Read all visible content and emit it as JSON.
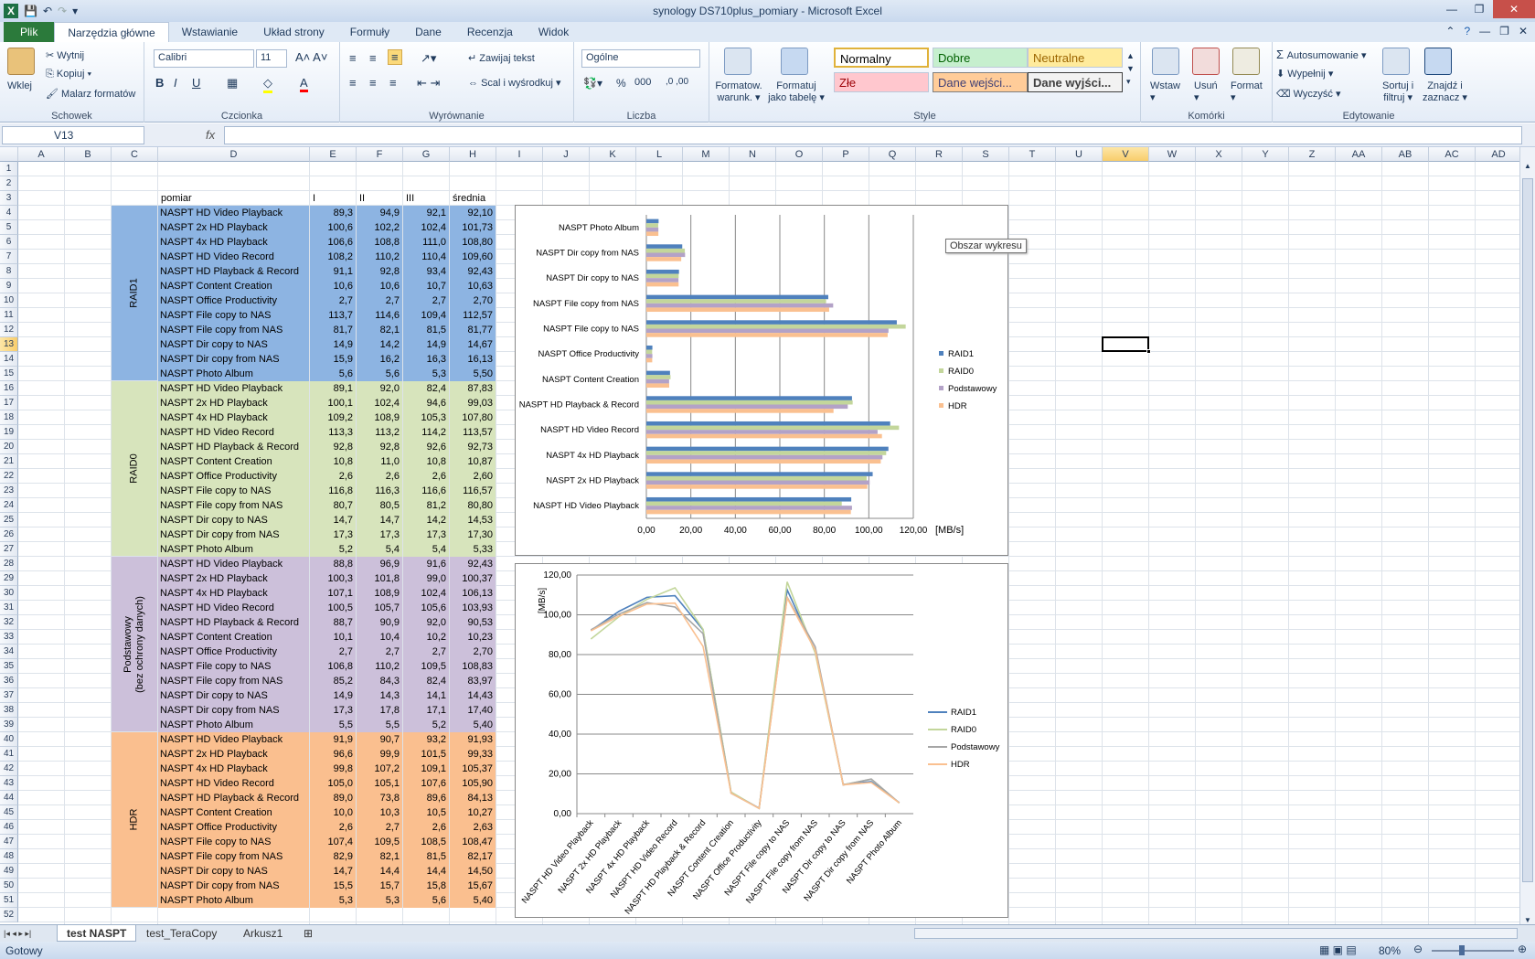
{
  "window": {
    "title": "synology DS710plus_pomiary  -  Microsoft Excel"
  },
  "ribbon_tabs": [
    "Plik",
    "Narzędzia główne",
    "Wstawianie",
    "Układ strony",
    "Formuły",
    "Dane",
    "Recenzja",
    "Widok"
  ],
  "ribbon": {
    "clipboard": {
      "paste": "Wklej",
      "cut": "Wytnij",
      "copy": "Kopiuj",
      "painter": "Malarz formatów",
      "label": "Schowek"
    },
    "font": {
      "name": "Calibri",
      "size": "11",
      "label": "Czcionka"
    },
    "alignment": {
      "wrap": "Zawijaj tekst",
      "merge": "Scal i wyśrodkuj",
      "label": "Wyrównanie"
    },
    "number": {
      "format": "Ogólne",
      "label": "Liczba"
    },
    "styles": {
      "cond_format": "Formatow.",
      "cond_format2": "warunk.",
      "as_table": "Formatuj",
      "as_table2": "jako tabelę",
      "normal": "Normalny",
      "good": "Dobre",
      "neutral": "Neutralne",
      "bad": "Złe",
      "input": "Dane wejści...",
      "output": "Dane wyjści...",
      "label": "Style"
    },
    "cells": {
      "insert": "Wstaw",
      "delete": "Usuń",
      "format": "Format",
      "label": "Komórki"
    },
    "editing": {
      "autosum": "Autosumowanie",
      "fill": "Wypełnij",
      "clear": "Wyczyść",
      "sort": "Sortuj i",
      "sort2": "filtruj",
      "find": "Znajdź i",
      "find2": "zaznacz",
      "label": "Edytowanie"
    }
  },
  "formula_bar": {
    "name_box": "V13",
    "fx": "fx",
    "value": ""
  },
  "columns": [
    "A",
    "B",
    "C",
    "D",
    "E",
    "F",
    "G",
    "H",
    "I",
    "J",
    "K",
    "L",
    "M",
    "N",
    "O",
    "P",
    "Q",
    "R",
    "S",
    "T",
    "U",
    "V",
    "W",
    "X",
    "Y",
    "Z",
    "AA",
    "AB",
    "AC",
    "AD"
  ],
  "table": {
    "headers": {
      "pomiar": "pomiar",
      "i": "I",
      "ii": "II",
      "iii": "III",
      "avg": "średnia"
    },
    "groups": [
      {
        "label": "RAID1",
        "color": "#8db4e2",
        "rows": [
          [
            "NASPT HD Video Playback",
            "89,3",
            "94,9",
            "92,1",
            "92,10"
          ],
          [
            "NASPT 2x HD Playback",
            "100,6",
            "102,2",
            "102,4",
            "101,73"
          ],
          [
            "NASPT 4x HD Playback",
            "106,6",
            "108,8",
            "111,0",
            "108,80"
          ],
          [
            "NASPT HD Video Record",
            "108,2",
            "110,2",
            "110,4",
            "109,60"
          ],
          [
            "NASPT HD Playback & Record",
            "91,1",
            "92,8",
            "93,4",
            "92,43"
          ],
          [
            "NASPT Content Creation",
            "10,6",
            "10,6",
            "10,7",
            "10,63"
          ],
          [
            "NASPT Office Productivity",
            "2,7",
            "2,7",
            "2,7",
            "2,70"
          ],
          [
            "NASPT File copy to NAS",
            "113,7",
            "114,6",
            "109,4",
            "112,57"
          ],
          [
            "NASPT File copy from NAS",
            "81,7",
            "82,1",
            "81,5",
            "81,77"
          ],
          [
            "NASPT Dir copy to NAS",
            "14,9",
            "14,2",
            "14,9",
            "14,67"
          ],
          [
            "NASPT Dir copy from NAS",
            "15,9",
            "16,2",
            "16,3",
            "16,13"
          ],
          [
            "NASPT Photo Album",
            "5,6",
            "5,6",
            "5,3",
            "5,50"
          ]
        ]
      },
      {
        "label": "RAID0",
        "color": "#d7e4bc",
        "rows": [
          [
            "NASPT HD Video Playback",
            "89,1",
            "92,0",
            "82,4",
            "87,83"
          ],
          [
            "NASPT 2x HD Playback",
            "100,1",
            "102,4",
            "94,6",
            "99,03"
          ],
          [
            "NASPT 4x HD Playback",
            "109,2",
            "108,9",
            "105,3",
            "107,80"
          ],
          [
            "NASPT HD Video Record",
            "113,3",
            "113,2",
            "114,2",
            "113,57"
          ],
          [
            "NASPT HD Playback & Record",
            "92,8",
            "92,8",
            "92,6",
            "92,73"
          ],
          [
            "NASPT Content Creation",
            "10,8",
            "11,0",
            "10,8",
            "10,87"
          ],
          [
            "NASPT Office Productivity",
            "2,6",
            "2,6",
            "2,6",
            "2,60"
          ],
          [
            "NASPT File copy to NAS",
            "116,8",
            "116,3",
            "116,6",
            "116,57"
          ],
          [
            "NASPT File copy from NAS",
            "80,7",
            "80,5",
            "81,2",
            "80,80"
          ],
          [
            "NASPT Dir copy to NAS",
            "14,7",
            "14,7",
            "14,2",
            "14,53"
          ],
          [
            "NASPT Dir copy from NAS",
            "17,3",
            "17,3",
            "17,3",
            "17,30"
          ],
          [
            "NASPT Photo Album",
            "5,2",
            "5,4",
            "5,4",
            "5,33"
          ]
        ]
      },
      {
        "label": "Podstawowy",
        "label2": "(bez ochrony danych)",
        "color": "#ccc0da",
        "rows": [
          [
            "NASPT HD Video Playback",
            "88,8",
            "96,9",
            "91,6",
            "92,43"
          ],
          [
            "NASPT 2x HD Playback",
            "100,3",
            "101,8",
            "99,0",
            "100,37"
          ],
          [
            "NASPT 4x HD Playback",
            "107,1",
            "108,9",
            "102,4",
            "106,13"
          ],
          [
            "NASPT HD Video Record",
            "100,5",
            "105,7",
            "105,6",
            "103,93"
          ],
          [
            "NASPT HD Playback & Record",
            "88,7",
            "90,9",
            "92,0",
            "90,53"
          ],
          [
            "NASPT Content Creation",
            "10,1",
            "10,4",
            "10,2",
            "10,23"
          ],
          [
            "NASPT Office Productivity",
            "2,7",
            "2,7",
            "2,7",
            "2,70"
          ],
          [
            "NASPT File copy to NAS",
            "106,8",
            "110,2",
            "109,5",
            "108,83"
          ],
          [
            "NASPT File copy from NAS",
            "85,2",
            "84,3",
            "82,4",
            "83,97"
          ],
          [
            "NASPT Dir copy to NAS",
            "14,9",
            "14,3",
            "14,1",
            "14,43"
          ],
          [
            "NASPT Dir copy from NAS",
            "17,3",
            "17,8",
            "17,1",
            "17,40"
          ],
          [
            "NASPT Photo Album",
            "5,5",
            "5,5",
            "5,2",
            "5,40"
          ]
        ]
      },
      {
        "label": "HDR",
        "color": "#fabf8f",
        "rows": [
          [
            "NASPT HD Video Playback",
            "91,9",
            "90,7",
            "93,2",
            "91,93"
          ],
          [
            "NASPT 2x HD Playback",
            "96,6",
            "99,9",
            "101,5",
            "99,33"
          ],
          [
            "NASPT 4x HD Playback",
            "99,8",
            "107,2",
            "109,1",
            "105,37"
          ],
          [
            "NASPT HD Video Record",
            "105,0",
            "105,1",
            "107,6",
            "105,90"
          ],
          [
            "NASPT HD Playback & Record",
            "89,0",
            "73,8",
            "89,6",
            "84,13"
          ],
          [
            "NASPT Content Creation",
            "10,0",
            "10,3",
            "10,5",
            "10,27"
          ],
          [
            "NASPT Office Productivity",
            "2,6",
            "2,7",
            "2,6",
            "2,63"
          ],
          [
            "NASPT File copy to NAS",
            "107,4",
            "109,5",
            "108,5",
            "108,47"
          ],
          [
            "NASPT File copy from NAS",
            "82,9",
            "82,1",
            "81,5",
            "82,17"
          ],
          [
            "NASPT Dir copy to NAS",
            "14,7",
            "14,4",
            "14,4",
            "14,50"
          ],
          [
            "NASPT Dir copy from NAS",
            "15,5",
            "15,7",
            "15,8",
            "15,67"
          ],
          [
            "NASPT Photo Album",
            "5,3",
            "5,3",
            "5,6",
            "5,40"
          ]
        ]
      }
    ]
  },
  "tooltip": "Obszar wykresu",
  "chart_data": [
    {
      "type": "bar",
      "orientation": "horizontal",
      "categories": [
        "NASPT HD Video Playback",
        "NASPT 2x HD Playback",
        "NASPT 4x HD Playback",
        "NASPT HD Video Record",
        "NASPT HD Playback & Record",
        "NASPT Content Creation",
        "NASPT Office Productivity",
        "NASPT File copy to NAS",
        "NASPT File copy from NAS",
        "NASPT Dir copy to NAS",
        "NASPT Dir copy from NAS",
        "NASPT Photo Album"
      ],
      "series": [
        {
          "name": "RAID1",
          "color": "#4f81bd",
          "values": [
            92.1,
            101.73,
            108.8,
            109.6,
            92.43,
            10.63,
            2.7,
            112.57,
            81.77,
            14.67,
            16.13,
            5.5
          ]
        },
        {
          "name": "RAID0",
          "color": "#c3d69b",
          "values": [
            87.83,
            99.03,
            107.8,
            113.57,
            92.73,
            10.87,
            2.6,
            116.57,
            80.8,
            14.53,
            17.3,
            5.33
          ]
        },
        {
          "name": "Podstawowy",
          "color": "#b3a2c7",
          "values": [
            92.43,
            100.37,
            106.13,
            103.93,
            90.53,
            10.23,
            2.7,
            108.83,
            83.97,
            14.43,
            17.4,
            5.4
          ]
        },
        {
          "name": "HDR",
          "color": "#fac090",
          "values": [
            91.93,
            99.33,
            105.37,
            105.9,
            84.13,
            10.27,
            2.63,
            108.47,
            82.17,
            14.5,
            15.67,
            5.4
          ]
        }
      ],
      "xticks": [
        "0,00",
        "20,00",
        "40,00",
        "60,00",
        "80,00",
        "100,00",
        "120,00"
      ],
      "xlim": [
        0,
        120
      ],
      "unit": "[MB/s]",
      "grid": true,
      "legend": "right"
    },
    {
      "type": "line",
      "categories": [
        "NASPT HD Video Playback",
        "NASPT 2x HD Playback",
        "NASPT 4x HD Playback",
        "NASPT HD Video Record",
        "NASPT HD Playback & Record",
        "NASPT Content Creation",
        "NASPT Office Productivity",
        "NASPT File copy to NAS",
        "NASPT File copy from NAS",
        "NASPT Dir copy to NAS",
        "NASPT Dir copy from NAS",
        "NASPT Photo Album"
      ],
      "series": [
        {
          "name": "RAID1",
          "color": "#4f81bd",
          "values": [
            92.1,
            101.73,
            108.8,
            109.6,
            92.43,
            10.63,
            2.7,
            112.57,
            81.77,
            14.67,
            16.13,
            5.5
          ]
        },
        {
          "name": "RAID0",
          "color": "#c3d69b",
          "values": [
            87.83,
            99.03,
            107.8,
            113.57,
            92.73,
            10.87,
            2.6,
            116.57,
            80.8,
            14.53,
            17.3,
            5.33
          ]
        },
        {
          "name": "Podstawowy",
          "color": "#a6a6a6",
          "values": [
            92.43,
            100.37,
            106.13,
            103.93,
            90.53,
            10.23,
            2.7,
            108.83,
            83.97,
            14.43,
            17.4,
            5.4
          ]
        },
        {
          "name": "HDR",
          "color": "#fac090",
          "values": [
            91.93,
            99.33,
            105.37,
            105.9,
            84.13,
            10.27,
            2.63,
            108.47,
            82.17,
            14.5,
            15.67,
            5.4
          ]
        }
      ],
      "yticks": [
        "0,00",
        "20,00",
        "40,00",
        "60,00",
        "80,00",
        "100,00",
        "120,00"
      ],
      "ylim": [
        0,
        120
      ],
      "ylabel": "[MB/s]",
      "grid": true,
      "legend": "right"
    }
  ],
  "sheet_tabs": [
    "test NASPT",
    "test_TeraCopy",
    "Arkusz1"
  ],
  "status": {
    "ready": "Gotowy",
    "zoom": "80%"
  }
}
